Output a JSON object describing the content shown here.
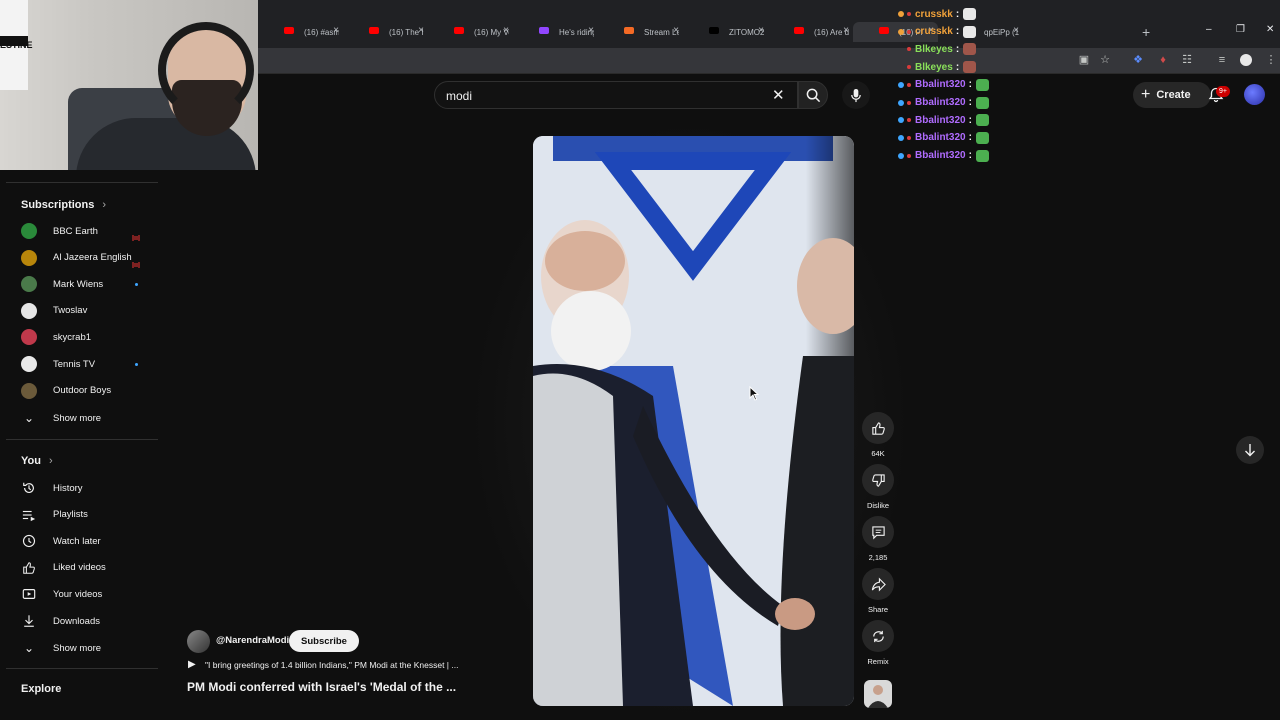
{
  "browser": {
    "tabs": [
      {
        "label": "(16) #asm",
        "fav": "#ff0000"
      },
      {
        "label": "(16) The Ir",
        "fav": "#ff0000"
      },
      {
        "label": "(16) My Ve",
        "fav": "#ff0000"
      },
      {
        "label": "He's riding",
        "fav": "#9146ff"
      },
      {
        "label": "Stream Let",
        "fav": "#f46a25"
      },
      {
        "label": "ZITOMO2",
        "fav": "#000000"
      },
      {
        "label": "(16) Are d",
        "fav": "#ff0000"
      },
      {
        "label": "(16) Pl",
        "fav": "#ff0000",
        "active": true
      },
      {
        "label": "qpEiPp (1",
        "fav": "#54b849"
      }
    ]
  },
  "search": {
    "value": "modi"
  },
  "header": {
    "create_label": "Create",
    "notif_badge": "9+"
  },
  "chat": [
    {
      "user": "crusskk",
      "color": "#f0a13a"
    },
    {
      "user": "crusskk",
      "color": "#f0a13a"
    },
    {
      "user": "Blkeyes",
      "color": "#8ae05a"
    },
    {
      "user": "Blkeyes",
      "color": "#8ae05a"
    },
    {
      "user": "Bbalint320",
      "color": "#b06cff"
    },
    {
      "user": "Bbalint320",
      "color": "#b06cff"
    },
    {
      "user": "Bbalint320",
      "color": "#b06cff"
    },
    {
      "user": "Bbalint320",
      "color": "#b06cff"
    },
    {
      "user": "Bbalint320",
      "color": "#b06cff"
    }
  ],
  "chat_sep": ":",
  "webcam": {
    "flag_text": "ESTINE"
  },
  "sidebar": {
    "subscriptions_title": "Subscriptions",
    "subscriptions": [
      {
        "label": "BBC Earth",
        "color": "#2a8a3a",
        "status": "live"
      },
      {
        "label": "Al Jazeera English",
        "color": "#b8860b",
        "status": "live"
      },
      {
        "label": "Mark Wiens",
        "color": "#4a7a4a",
        "status": "new"
      },
      {
        "label": "Twoslav",
        "color": "#e6e6e6",
        "status": ""
      },
      {
        "label": "skycrab1",
        "color": "#c0394b",
        "status": ""
      },
      {
        "label": "Tennis TV",
        "color": "#e8e8e8",
        "status": "new"
      },
      {
        "label": "Outdoor Boys",
        "color": "#6b5a3a",
        "status": ""
      }
    ],
    "show_more_1": "Show more",
    "you_title": "You",
    "you_items": [
      {
        "label": "History",
        "icon": "history-icon"
      },
      {
        "label": "Playlists",
        "icon": "playlists-icon"
      },
      {
        "label": "Watch later",
        "icon": "watch-later-icon"
      },
      {
        "label": "Liked videos",
        "icon": "liked-icon"
      },
      {
        "label": "Your videos",
        "icon": "your-videos-icon"
      },
      {
        "label": "Downloads",
        "icon": "download-icon"
      }
    ],
    "show_more_2": "Show more",
    "explore_title": "Explore"
  },
  "short": {
    "like_count": "64K",
    "dislike_label": "Dislike",
    "comment_count": "2,185",
    "share_label": "Share",
    "remix_label": "Remix",
    "channel": "@NarendraModi",
    "subscribe_label": "Subscribe",
    "description": "\"I bring greetings of 1.4 billion Indians,\" PM Modi at the Knesset | ...",
    "title": "PM Modi conferred with Israel's 'Medal of the ..."
  },
  "colors": {
    "background": "#0f0f0f",
    "accent": "#cc0000"
  }
}
